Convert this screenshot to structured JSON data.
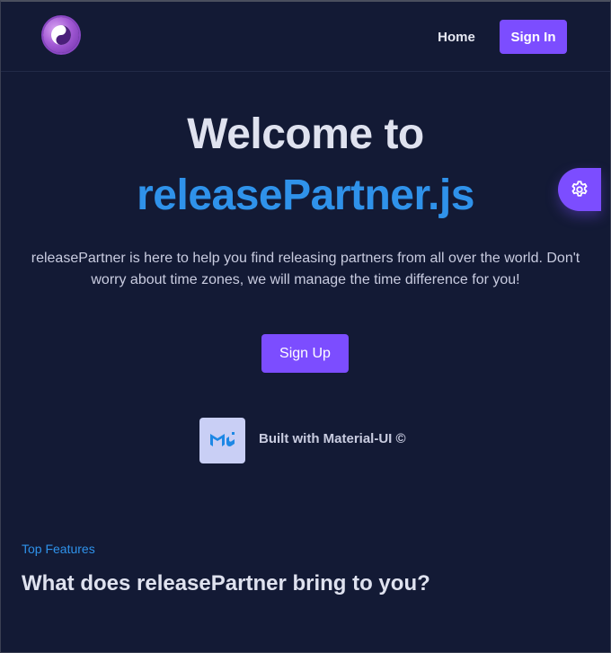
{
  "header": {
    "logo_icon": "yin-yang-icon",
    "nav": {
      "home_label": "Home"
    },
    "signin_label": "Sign In"
  },
  "hero": {
    "title_line1": "Welcome to",
    "title_line2": "releasePartner.js",
    "description": "releasePartner is here to help you find releasing partners from all over the world. Don't worry about time zones, we will manage the time difference for you!",
    "signup_label": "Sign Up"
  },
  "badge": {
    "icon": "material-ui-logo-icon",
    "text": "Built with Material-UI ©"
  },
  "features": {
    "kicker": "Top Features",
    "title": "What does releasePartner bring to you?"
  },
  "settings_fab": {
    "icon": "gear-icon"
  },
  "colors": {
    "background": "#131a35",
    "accent": "#7c4dff",
    "brand_blue": "#2f92ea",
    "heading": "#dfe2ef"
  }
}
